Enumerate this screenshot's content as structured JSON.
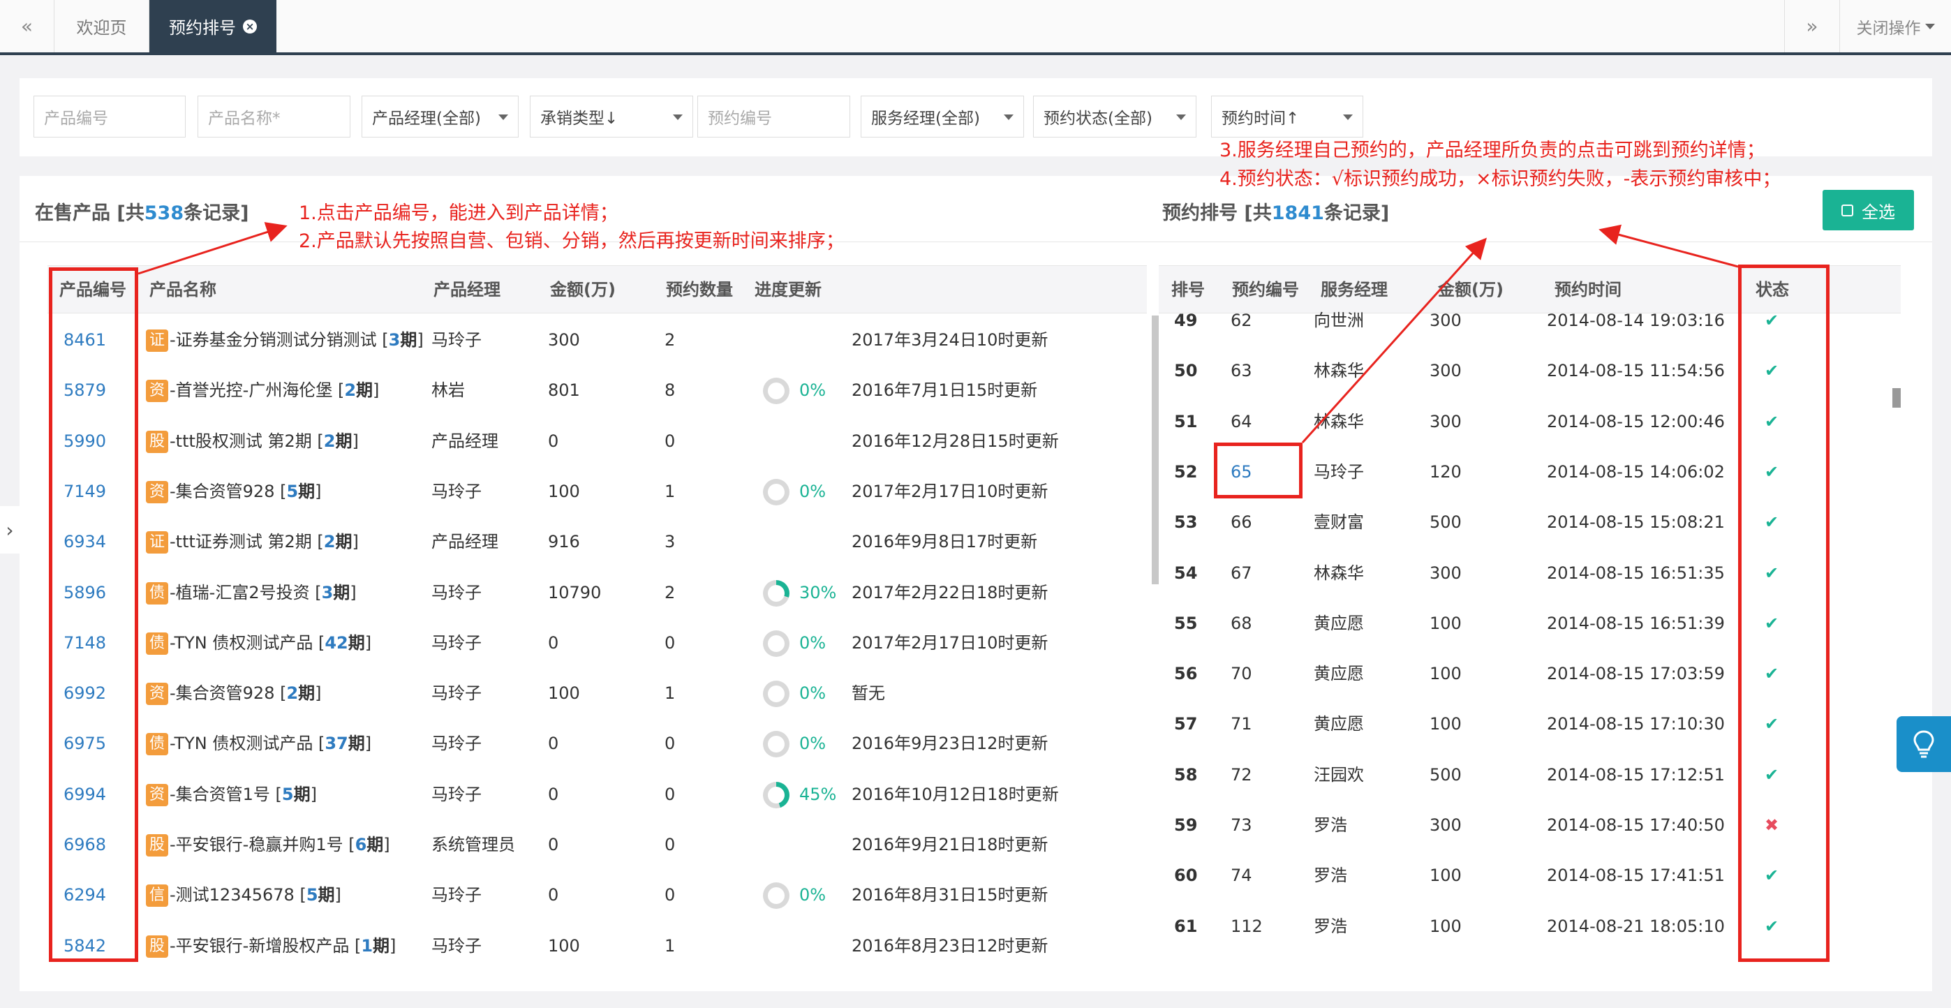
{
  "tabs": {
    "prev": "«",
    "welcome": "欢迎页",
    "active": "预约排号",
    "next": "»",
    "close_ops": "关闭操作"
  },
  "filters": {
    "product_no": "产品编号",
    "product_name": "产品名称*",
    "product_manager": "产品经理(全部)",
    "underwriting": "承销类型↓",
    "reservation_no": "预约编号",
    "service_manager": "服务经理(全部)",
    "status": "预约状态(全部)",
    "time": "预约时间↑"
  },
  "left_section": {
    "title_pre": "在售产品 [共",
    "count": "538",
    "title_post": "条记录]"
  },
  "right_section": {
    "title_pre": "预约排号 [共",
    "count": "1841",
    "title_post": "条记录]",
    "select_all": "全选"
  },
  "annotations": {
    "a1": "1.点击产品编号，能进入到产品详情；",
    "a2": "2.产品默认先按照自营、包销、分销，然后再按更新时间来排序；",
    "a3": "3.服务经理自己预约的，产品经理所负责的点击可跳到预约详情；",
    "a4": "4.预约状态：√标识预约成功，×标识预约失败，-表示预约审核中；"
  },
  "left_headers": {
    "no": "产品编号",
    "name": "产品名称",
    "manager": "产品经理",
    "amount": "金额(万)",
    "count": "预约数量",
    "progress": "进度更新"
  },
  "products": [
    {
      "no": "8461",
      "tag": "证",
      "name": "-证券基金分销测试分销测试 [",
      "period": "3",
      "psuffix": "期",
      "close": "]",
      "manager": "马玲子",
      "amount": "300",
      "count": "2",
      "pct": "",
      "update": "2017年3月24日10时更新"
    },
    {
      "no": "5879",
      "tag": "资",
      "name": "-首誉光控-广州海伦堡 [",
      "period": "2",
      "psuffix": "期",
      "close": "]",
      "manager": "林岩",
      "amount": "801",
      "count": "8",
      "pct": "0%",
      "update": "2016年7月1日15时更新"
    },
    {
      "no": "5990",
      "tag": "股",
      "name": "-ttt股权测试 第2期 [",
      "period": "2",
      "psuffix": "期",
      "close": "]",
      "manager": "产品经理",
      "amount": "0",
      "count": "0",
      "pct": "",
      "update": "2016年12月28日15时更新"
    },
    {
      "no": "7149",
      "tag": "资",
      "name": "-集合资管928 [",
      "period": "5",
      "psuffix": "期",
      "close": "]",
      "manager": "马玲子",
      "amount": "100",
      "count": "1",
      "pct": "0%",
      "update": "2017年2月17日10时更新"
    },
    {
      "no": "6934",
      "tag": "证",
      "name": "-ttt证券测试 第2期 [",
      "period": "2",
      "psuffix": "期",
      "close": "]",
      "manager": "产品经理",
      "amount": "916",
      "count": "3",
      "pct": "",
      "update": "2016年9月8日17时更新"
    },
    {
      "no": "5896",
      "tag": "债",
      "name": "-植瑞-汇富2号投资 [",
      "period": "3",
      "psuffix": "期",
      "close": "]",
      "manager": "马玲子",
      "amount": "10790",
      "count": "2",
      "pct": "30%",
      "update": "2017年2月22日18时更新"
    },
    {
      "no": "7148",
      "tag": "债",
      "name": "-TYN 债权测试产品 [",
      "period": "42",
      "psuffix": "期",
      "close": "]",
      "manager": "马玲子",
      "amount": "0",
      "count": "0",
      "pct": "0%",
      "update": "2017年2月17日10时更新"
    },
    {
      "no": "6992",
      "tag": "资",
      "name": "-集合资管928 [",
      "period": "2",
      "psuffix": "期",
      "close": "]",
      "manager": "马玲子",
      "amount": "100",
      "count": "1",
      "pct": "0%",
      "update": "暂无"
    },
    {
      "no": "6975",
      "tag": "债",
      "name": "-TYN 债权测试产品 [",
      "period": "37",
      "psuffix": "期",
      "close": "]",
      "manager": "马玲子",
      "amount": "0",
      "count": "0",
      "pct": "0%",
      "update": "2016年9月23日12时更新"
    },
    {
      "no": "6994",
      "tag": "资",
      "name": "-集合资管1号 [",
      "period": "5",
      "psuffix": "期",
      "close": "]",
      "manager": "马玲子",
      "amount": "0",
      "count": "0",
      "pct": "45%",
      "update": "2016年10月12日18时更新"
    },
    {
      "no": "6968",
      "tag": "股",
      "name": "-平安银行-稳赢并购1号 [",
      "period": "6",
      "psuffix": "期",
      "close": "]",
      "manager": "系统管理员",
      "amount": "0",
      "count": "0",
      "pct": "",
      "update": "2016年9月21日18时更新"
    },
    {
      "no": "6294",
      "tag": "信",
      "name": "-测试12345678 [",
      "period": "5",
      "psuffix": "期",
      "close": "]",
      "manager": "马玲子",
      "amount": "0",
      "count": "0",
      "pct": "0%",
      "update": "2016年8月31日15时更新"
    },
    {
      "no": "5842",
      "tag": "股",
      "name": "-平安银行-新增股权产品 [",
      "period": "1",
      "psuffix": "期",
      "close": "]",
      "manager": "马玲子",
      "amount": "100",
      "count": "1",
      "pct": "",
      "update": "2016年8月23日12时更新"
    }
  ],
  "right_headers": {
    "rank": "排号",
    "res_no": "预约编号",
    "svc": "服务经理",
    "amount": "金额(万)",
    "time": "预约时间",
    "status": "状态"
  },
  "reservations": [
    {
      "rank": "49",
      "no": "62",
      "svc": "向世洲",
      "amount": "300",
      "time": "2014-08-14 19:03:16",
      "status": "✔"
    },
    {
      "rank": "50",
      "no": "63",
      "svc": "林森华",
      "amount": "300",
      "time": "2014-08-15 11:54:56",
      "status": "✔"
    },
    {
      "rank": "51",
      "no": "64",
      "svc": "林森华",
      "amount": "300",
      "time": "2014-08-15 12:00:46",
      "status": "✔"
    },
    {
      "rank": "52",
      "no": "65",
      "svc": "马玲子",
      "amount": "120",
      "time": "2014-08-15 14:06:02",
      "status": "✔"
    },
    {
      "rank": "53",
      "no": "66",
      "svc": "壹财富",
      "amount": "500",
      "time": "2014-08-15 15:08:21",
      "status": "✔"
    },
    {
      "rank": "54",
      "no": "67",
      "svc": "林森华",
      "amount": "300",
      "time": "2014-08-15 16:51:35",
      "status": "✔"
    },
    {
      "rank": "55",
      "no": "68",
      "svc": "黄应愿",
      "amount": "100",
      "time": "2014-08-15 16:51:39",
      "status": "✔"
    },
    {
      "rank": "56",
      "no": "70",
      "svc": "黄应愿",
      "amount": "100",
      "time": "2014-08-15 17:03:59",
      "status": "✔"
    },
    {
      "rank": "57",
      "no": "71",
      "svc": "黄应愿",
      "amount": "100",
      "time": "2014-08-15 17:10:30",
      "status": "✔"
    },
    {
      "rank": "58",
      "no": "72",
      "svc": "汪园欢",
      "amount": "500",
      "time": "2014-08-15 17:12:51",
      "status": "✔"
    },
    {
      "rank": "59",
      "no": "73",
      "svc": "罗浩",
      "amount": "300",
      "time": "2014-08-15 17:40:50",
      "status": "✖"
    },
    {
      "rank": "60",
      "no": "74",
      "svc": "罗浩",
      "amount": "100",
      "time": "2014-08-15 17:41:51",
      "status": "✔"
    },
    {
      "rank": "61",
      "no": "112",
      "svc": "罗浩",
      "amount": "100",
      "time": "2014-08-21 18:05:10",
      "status": "✔"
    }
  ],
  "colors": {
    "accent": "#1ab394",
    "link": "#2e7bc0",
    "dark": "#2f4050",
    "tag": "#f39c3c",
    "annotation": "#e8231e",
    "fail": "#e74c5e"
  },
  "icons": {
    "side_toggle": "chevron-right-icon",
    "help": "lightbulb-icon",
    "tab_close": "close-icon"
  }
}
